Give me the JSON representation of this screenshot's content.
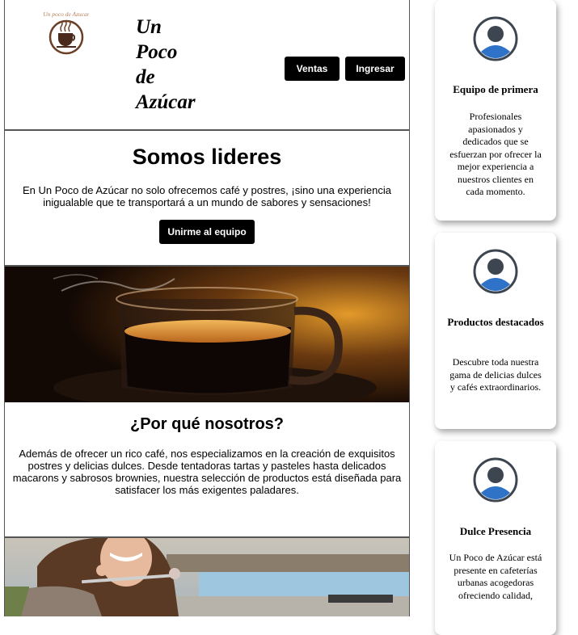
{
  "header": {
    "logo_text": "Un poco de Azucar",
    "brand_lines": [
      "Un",
      "Poco",
      "de",
      "Azúcar"
    ],
    "ventas_label": "Ventas",
    "ingresar_label": "Ingresar"
  },
  "hero": {
    "title": "Somos lideres",
    "text": "En Un Poco de Azúcar no solo ofrecemos café y postres, ¡sino una experiencia inigualable que te transportará a un mundo de sabores y sensaciones!",
    "cta_label": "Unirme al equipo"
  },
  "why": {
    "title": "¿Por qué nosotros?",
    "text": "Además de ofrecer un rico café, nos especializamos en la creación de exquisitos postres y delicias dulces. Desde tentadoras tartas y pasteles hasta delicados macarons y sabrosos brownies, nuestra selección de productos está diseñada para satisfacer los más exigentes paladares."
  },
  "cards": [
    {
      "title": "Equipo de primera",
      "text": "Profesionales apasionados y dedicados que se esfuerzan por ofrecer la mejor experiencia a nuestros clientes en cada momento."
    },
    {
      "title": "Productos destacados",
      "text": "Descubre toda nuestra gama de delicias dulces y cafés extraordinarios."
    },
    {
      "title": "Dulce Presencia",
      "text": "Un Poco de Azúcar está presente en cafeterías urbanas acogedoras ofreciendo calidad,"
    }
  ],
  "icons": {
    "logo": "coffee-cup-logo-icon",
    "avatar": "user-avatar-icon"
  },
  "colors": {
    "accent": "#000000",
    "avatar_blue": "#2f73c9",
    "avatar_dark": "#3d4550"
  }
}
